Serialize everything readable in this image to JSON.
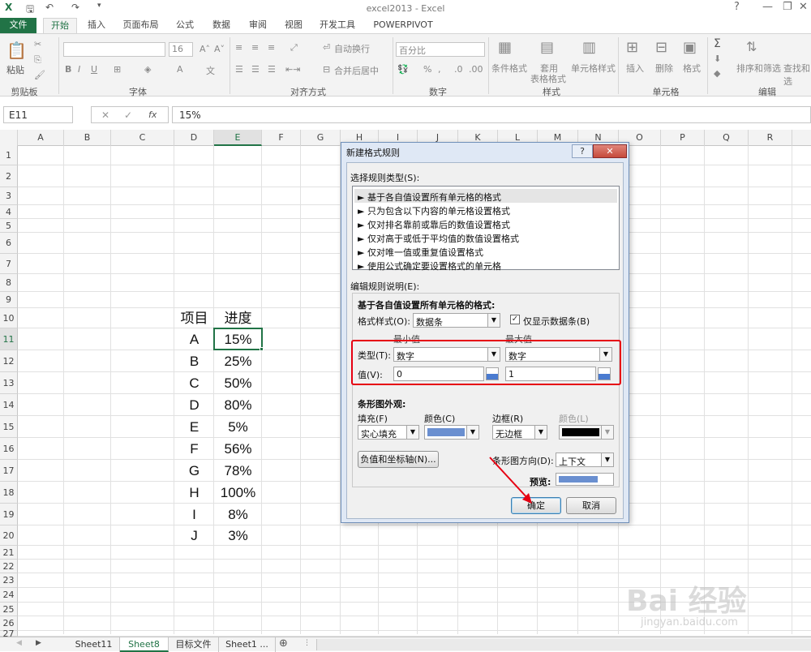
{
  "window": {
    "title": "excel2013 - Excel",
    "help": "?",
    "min": "—",
    "restore": "❐",
    "close": "✕"
  },
  "tabs": [
    "文件",
    "开始",
    "插入",
    "页面布局",
    "公式",
    "数据",
    "审阅",
    "视图",
    "开发工具",
    "POWERPIVOT"
  ],
  "ribbon": {
    "groups": [
      "剪贴板",
      "字体",
      "对齐方式",
      "数字",
      "样式",
      "单元格",
      "编辑"
    ],
    "paste": "粘贴",
    "font_size": "16",
    "wrap": "自动换行",
    "merge": "合并后居中",
    "number_format": "百分比",
    "cond_format": "条件格式",
    "table_format_1": "套用",
    "table_format_2": "表格格式",
    "cell_style": "单元格样式",
    "insert": "插入",
    "delete": "删除",
    "format": "格式",
    "sort_filter": "排序和筛选",
    "find_select": "查找和选"
  },
  "formula_bar": {
    "name_box": "E11",
    "fx": "fx",
    "value": "15%"
  },
  "columns": [
    "A",
    "B",
    "C",
    "D",
    "E",
    "F",
    "G",
    "H",
    "I",
    "J",
    "K",
    "L",
    "M",
    "N",
    "O",
    "P",
    "Q",
    "R"
  ],
  "rows": [
    "1",
    "2",
    "3",
    "4",
    "5",
    "6",
    "7",
    "8",
    "9",
    "10",
    "11",
    "12",
    "13",
    "14",
    "15",
    "16",
    "17",
    "18",
    "19",
    "20",
    "21",
    "22",
    "23",
    "24",
    "25",
    "26",
    "27"
  ],
  "table": {
    "header_item": "项目",
    "header_progress": "进度",
    "items": [
      {
        "k": "A",
        "v": "15%"
      },
      {
        "k": "B",
        "v": "25%"
      },
      {
        "k": "C",
        "v": "50%"
      },
      {
        "k": "D",
        "v": "80%"
      },
      {
        "k": "E",
        "v": "5%"
      },
      {
        "k": "F",
        "v": "56%"
      },
      {
        "k": "G",
        "v": "78%"
      },
      {
        "k": "H",
        "v": "100%"
      },
      {
        "k": "I",
        "v": "8%"
      },
      {
        "k": "J",
        "v": "3%"
      }
    ]
  },
  "sheets": [
    "Sheet11",
    "Sheet8",
    "目标文件",
    "Sheet1 ..."
  ],
  "active_sheet": "Sheet8",
  "dialog": {
    "title": "新建格式规则",
    "select_type_label": "选择规则类型(S):",
    "rule_types": [
      "► 基于各自值设置所有单元格的格式",
      "► 只为包含以下内容的单元格设置格式",
      "► 仅对排名靠前或靠后的数值设置格式",
      "► 仅对高于或低于平均值的数值设置格式",
      "► 仅对唯一值或重复值设置格式",
      "► 使用公式确定要设置格式的单元格"
    ],
    "edit_desc_label": "编辑规则说明(E):",
    "format_all_label": "基于各自值设置所有单元格的格式:",
    "format_style_label": "格式样式(O):",
    "format_style_value": "数据条",
    "show_bar_only": "仅显示数据条(B)",
    "min_label": "最小值",
    "max_label": "最大值",
    "type_label": "类型(T):",
    "value_label": "值(V):",
    "min_type": "数字",
    "max_type": "数字",
    "min_value": "0",
    "max_value": "1",
    "bar_appearance": "条形图外观:",
    "fill_label": "填充(F)",
    "color_label": "颜色(C)",
    "border_label": "边框(R)",
    "border_color_label": "颜色(L)",
    "fill_value": "实心填充",
    "border_value": "无边框",
    "fill_color": "#6a8fd0",
    "border_color": "#000000",
    "neg_axis_button": "负值和坐标轴(N)...",
    "direction_label": "条形图方向(D):",
    "direction_value": "上下文",
    "preview_label": "预览:",
    "ok": "确定",
    "cancel": "取消"
  },
  "watermark": {
    "brand": "Bai 经验",
    "url": "jingyan.baidu.com"
  }
}
